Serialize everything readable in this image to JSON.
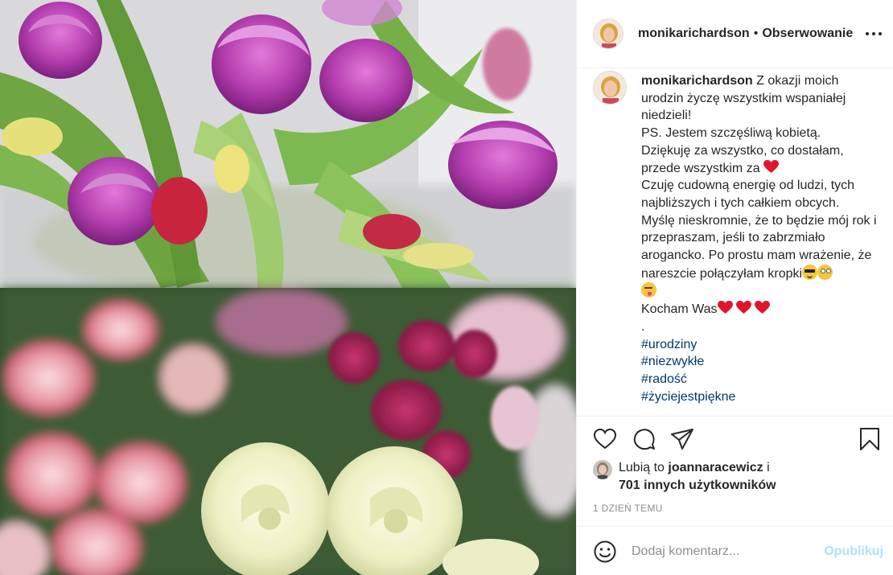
{
  "post": {
    "username": "monikarichardson",
    "header_dot": "•",
    "follow_label": "Obserwowanie",
    "more_icon": "more-options-icon",
    "caption": {
      "username": "monikarichardson",
      "line1": "Z okazji moich urodzin życzę wszystkim wspaniałej niedzieli!",
      "line2": "PS. Jestem szczęśliwą kobietą.",
      "line3": "Dziękuję za wszystko, co dostałam, przede wszystkim za",
      "line4": "Czuję cudowną energię od ludzi, tych najbliższych i tych całkiem obcych.",
      "line5": "Myślę nieskromnie, że to będzie mój rok i przepraszam, jeśli to zabrzmiało arogancko. Po prostu mam wrażenie, że nareszcie połączyłam kropki",
      "line6": "Kocham Was",
      "dot": ".",
      "hashtags": [
        "#urodziny",
        "#niezwykłe",
        "#radość",
        "#życiejestpiękne"
      ]
    },
    "likes": {
      "prefix": "Lubią to",
      "user": "joannaracewicz",
      "connector": "i",
      "others": "701 innych użytkowników"
    },
    "timestamp": "1 DZIEŃ TEMU",
    "comment": {
      "placeholder": "Dodaj komentarz...",
      "post_label": "Opublikuj"
    },
    "photo_description_icons": [
      "heart-outline-icon",
      "comment-icon",
      "share-icon",
      "bookmark-icon",
      "emoji-icon"
    ],
    "colors": {
      "text": "#262626",
      "secondary": "#8e8e8e",
      "hashtag": "#00376b",
      "post_button_disabled": "#b2dffc",
      "heart": "#ed4956"
    }
  }
}
